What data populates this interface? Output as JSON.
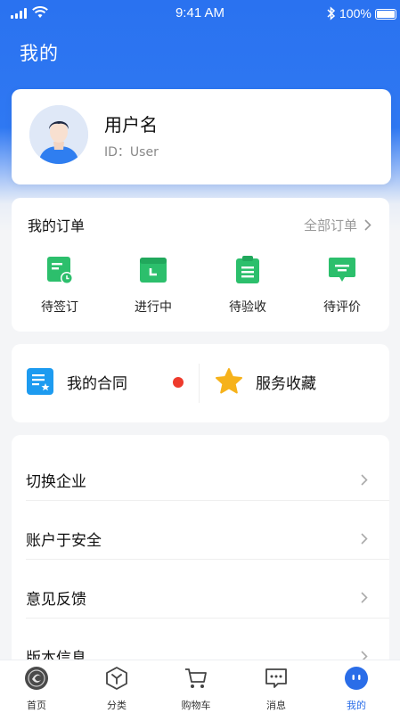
{
  "status_bar": {
    "time": "9:41 AM",
    "battery": "100%"
  },
  "header": {
    "title": "我的"
  },
  "profile": {
    "username": "用户名",
    "user_id": "ID：User"
  },
  "orders": {
    "title": "我的订单",
    "all_label": "全部订单",
    "items": [
      {
        "label": "待签订",
        "icon": "sign-doc-icon"
      },
      {
        "label": "进行中",
        "icon": "in-progress-icon"
      },
      {
        "label": "待验收",
        "icon": "acceptance-clipboard-icon"
      },
      {
        "label": "待评价",
        "icon": "review-chat-icon"
      }
    ]
  },
  "shortcuts": {
    "contracts": {
      "label": "我的合同",
      "icon": "contract-doc-icon"
    },
    "favorites": {
      "label": "服务收藏",
      "icon": "star-icon"
    }
  },
  "menu": [
    {
      "label": "切换企业"
    },
    {
      "label": "账户于安全"
    },
    {
      "label": "意见反馈"
    },
    {
      "label": "版本信息"
    }
  ],
  "tabbar": [
    {
      "label": "首页",
      "icon": "home-logo-icon"
    },
    {
      "label": "分类",
      "icon": "category-icon"
    },
    {
      "label": "购物车",
      "icon": "cart-icon"
    },
    {
      "label": "消息",
      "icon": "message-icon"
    },
    {
      "label": "我的",
      "icon": "profile-face-icon",
      "active": true
    }
  ],
  "colors": {
    "primary": "#2a72f0",
    "green": "#2cbf6c",
    "red_dot": "#ee3a2c",
    "star": "#f6b21b"
  }
}
